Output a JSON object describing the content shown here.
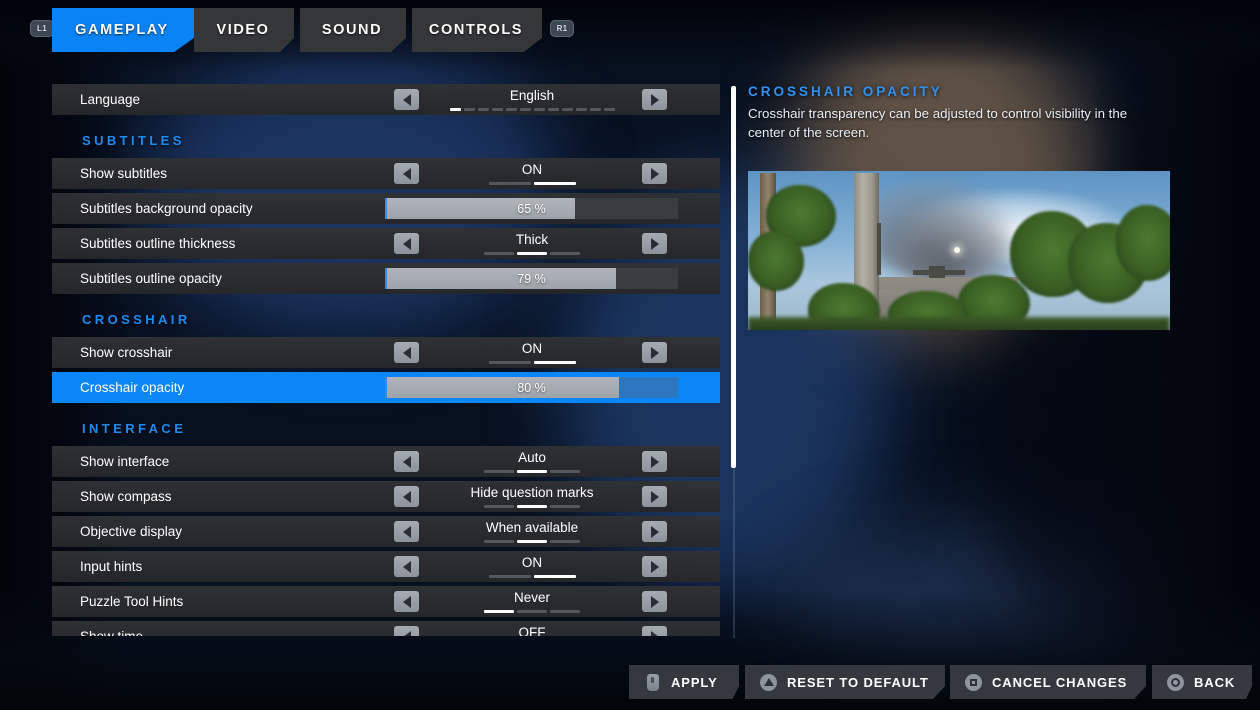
{
  "shoulder_buttons": {
    "left": "L1",
    "right": "R1"
  },
  "tabs": [
    {
      "label": "GAMEPLAY",
      "active": true
    },
    {
      "label": "VIDEO",
      "active": false
    },
    {
      "label": "SOUND",
      "active": false
    },
    {
      "label": "CONTROLS",
      "active": false
    }
  ],
  "settings": [
    {
      "kind": "option",
      "name": "language",
      "label": "Language",
      "value": "English",
      "segments": 12,
      "segment_index": 0,
      "selected": false
    },
    {
      "kind": "section",
      "name": "subtitles",
      "label": "SUBTITLES"
    },
    {
      "kind": "option",
      "name": "show-subtitles",
      "label": "Show subtitles",
      "value": "ON",
      "segments": 2,
      "segment_index": 1,
      "selected": false
    },
    {
      "kind": "slider",
      "name": "subtitles-background-opacity",
      "label": "Subtitles background opacity",
      "value": "65 %",
      "percent": 65,
      "selected": false
    },
    {
      "kind": "option",
      "name": "subtitles-outline-thickness",
      "label": "Subtitles outline thickness",
      "value": "Thick",
      "segments": 3,
      "segment_index": 1,
      "selected": false
    },
    {
      "kind": "slider",
      "name": "subtitles-outline-opacity",
      "label": "Subtitles outline opacity",
      "value": "79 %",
      "percent": 79,
      "selected": false
    },
    {
      "kind": "section",
      "name": "crosshair",
      "label": "CROSSHAIR"
    },
    {
      "kind": "option",
      "name": "show-crosshair",
      "label": "Show crosshair",
      "value": "ON",
      "segments": 2,
      "segment_index": 1,
      "selected": false
    },
    {
      "kind": "slider",
      "name": "crosshair-opacity",
      "label": "Crosshair opacity",
      "value": "80 %",
      "percent": 80,
      "selected": true
    },
    {
      "kind": "section",
      "name": "interface",
      "label": "INTERFACE"
    },
    {
      "kind": "option",
      "name": "show-interface",
      "label": "Show interface",
      "value": "Auto",
      "segments": 3,
      "segment_index": 1,
      "selected": false
    },
    {
      "kind": "option",
      "name": "show-compass",
      "label": "Show compass",
      "value": "Hide question marks",
      "segments": 3,
      "segment_index": 1,
      "selected": false
    },
    {
      "kind": "option",
      "name": "objective-display",
      "label": "Objective display",
      "value": "When available",
      "segments": 3,
      "segment_index": 1,
      "selected": false
    },
    {
      "kind": "option",
      "name": "input-hints",
      "label": "Input hints",
      "value": "ON",
      "segments": 2,
      "segment_index": 1,
      "selected": false
    },
    {
      "kind": "option",
      "name": "puzzle-tool-hints",
      "label": "Puzzle Tool Hints",
      "value": "Never",
      "segments": 3,
      "segment_index": 0,
      "selected": false
    },
    {
      "kind": "option",
      "name": "show-time",
      "label": "Show time",
      "value": "OFF",
      "segments": 2,
      "segment_index": 0,
      "selected": false
    }
  ],
  "info": {
    "title": "CROSSHAIR OPACITY",
    "description": "Crosshair transparency can be adjusted to control visibility in the center of the screen."
  },
  "actions": [
    {
      "label": "APPLY",
      "glyph": "trigger-button-icon"
    },
    {
      "label": "RESET TO DEFAULT",
      "glyph": "triangle-button-icon"
    },
    {
      "label": "CANCEL CHANGES",
      "glyph": "square-button-icon"
    },
    {
      "label": "BACK",
      "glyph": "circle-button-icon"
    }
  ],
  "colors": {
    "accent_blue": "#0a84f5",
    "section_heading_blue": "#1b8cf5",
    "row_background": "#303134",
    "slider_fill": "#a9aeb5",
    "slider_track": "#3a3c40"
  }
}
